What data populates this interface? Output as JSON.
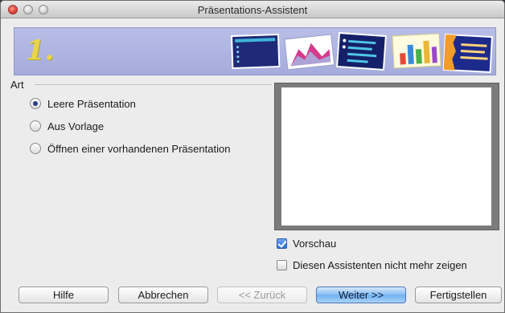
{
  "window": {
    "title": "Präsentations-Assistent"
  },
  "banner": {
    "step_number": "1.",
    "colors": {
      "background": "#aab0e0",
      "step_number": "#e8d54a"
    }
  },
  "art_group": {
    "label": "Art",
    "options": [
      {
        "label": "Leere Präsentation",
        "selected": true
      },
      {
        "label": "Aus Vorlage",
        "selected": false
      },
      {
        "label": "Öffnen einer vorhandenen Präsentation",
        "selected": false
      }
    ]
  },
  "preview": {
    "show_preview_label": "Vorschau",
    "show_preview_checked": true,
    "dont_show_again_label": "Diesen Assistenten nicht mehr zeigen",
    "dont_show_again_checked": false
  },
  "buttons": {
    "help": "Hilfe",
    "cancel": "Abbrechen",
    "back": "<< Zurück",
    "back_enabled": false,
    "next": "Weiter >>",
    "finish": "Fertigstellen"
  }
}
